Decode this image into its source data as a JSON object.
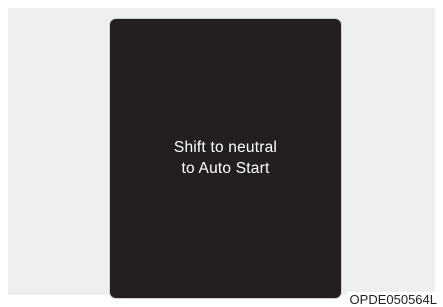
{
  "display": {
    "message_line1": "Shift to neutral",
    "message_line2": "to Auto Start"
  },
  "figure": {
    "code": "OPDE050564L"
  },
  "colors": {
    "screen_background": "#231f20",
    "message_text": "#ffffff",
    "frame_background": "#efefef"
  }
}
